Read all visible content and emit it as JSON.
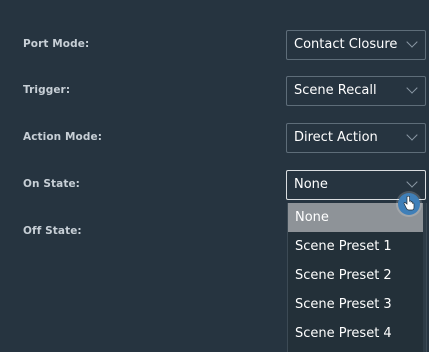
{
  "fields": [
    {
      "label": "Port Mode:",
      "value": "Contact Closure"
    },
    {
      "label": "Trigger:",
      "value": "Scene Recall"
    },
    {
      "label": "Action Mode:",
      "value": "Direct Action"
    },
    {
      "label": "On State:",
      "value": "None"
    },
    {
      "label": "Off State:"
    }
  ],
  "dropdown": {
    "options": [
      "None",
      "Scene Preset 1",
      "Scene Preset 2",
      "Scene Preset 3",
      "Scene Preset 4"
    ],
    "selected": "None"
  },
  "colors": {
    "background": "#263440",
    "label_text": "#c7cfd6",
    "select_border": "#5e6d79",
    "selected_option_bg": "#8e9398",
    "cursor_accent": "#3f7fb8"
  },
  "icons": {
    "select_chevron": "chevron-down-icon",
    "cursor": "hand-pointer-icon"
  }
}
